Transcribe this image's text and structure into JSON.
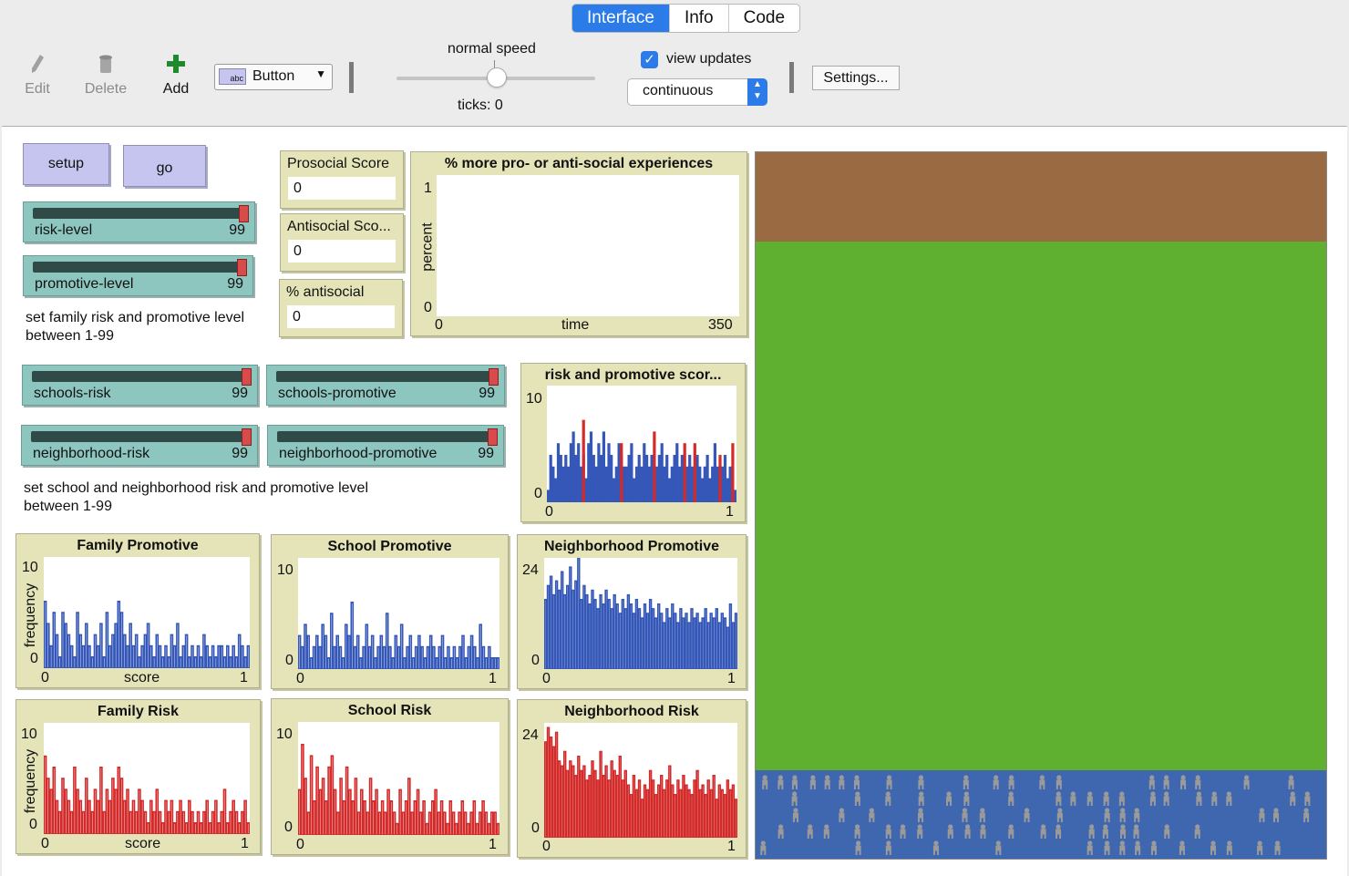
{
  "tabs": [
    "Interface",
    "Info",
    "Code"
  ],
  "toolbar": {
    "edit": "Edit",
    "delete": "Delete",
    "add": "Add",
    "widget_type": "Button",
    "speed_label": "normal speed",
    "speed_level": 0.5,
    "ticks": "ticks: 0",
    "view_updates": "view updates",
    "view_updates_checked": true,
    "update_mode": "continuous",
    "settings": "Settings..."
  },
  "buttons": {
    "setup": "setup",
    "go": "go"
  },
  "sliders": [
    {
      "name": "risk-level",
      "value": "99"
    },
    {
      "name": "promotive-level",
      "value": "99"
    },
    {
      "name": "schools-risk",
      "value": "99"
    },
    {
      "name": "schools-promotive",
      "value": "99"
    },
    {
      "name": "neighborhood-risk",
      "value": "99"
    },
    {
      "name": "neighborhood-promotive",
      "value": "99"
    }
  ],
  "notes": {
    "family": [
      "set family risk and promotive level",
      "between 1-99"
    ],
    "school": [
      "set school and neighborhood risk and promotive level",
      "between 1-99"
    ]
  },
  "monitors": [
    {
      "label": "Prosocial Score",
      "value": "0"
    },
    {
      "label": "Antisocial Sco...",
      "value": "0"
    },
    {
      "label": "% antisocial",
      "value": "0"
    }
  ],
  "main_plot": {
    "title": "% more pro- or anti-social experiences",
    "ylabel": "percent",
    "xlabel": "time",
    "ymax": "1",
    "ymin": "0",
    "xmin": "0",
    "xmax": "350"
  },
  "colors": {
    "blue": "#3457b8",
    "red": "#d32a2a",
    "patch_top": "#9a6b43",
    "patch_mid": "#5faf30",
    "patch_bottom": "#3f67b0",
    "turtle": "#9a9a9a"
  },
  "chart_data": [
    {
      "type": "bar",
      "title": "risk and promotive scor...",
      "ymax": "10",
      "ymin": "0",
      "xmin": "0",
      "xmax": "1",
      "series": [
        {
          "color": "blue",
          "values": [
            1,
            4,
            3,
            2,
            5,
            4,
            3,
            4,
            3,
            5,
            6,
            4,
            5,
            3,
            4,
            2,
            5,
            6,
            4,
            3,
            5,
            4,
            6,
            3,
            5,
            4,
            2,
            3,
            5,
            4,
            3,
            3,
            4,
            5,
            2,
            3,
            4,
            3,
            5,
            4,
            3,
            4,
            2,
            3,
            4,
            5,
            3,
            4,
            2,
            3,
            4,
            5,
            3,
            4,
            2,
            3,
            4,
            3,
            2,
            4,
            3,
            2,
            3,
            4,
            2,
            3,
            5,
            3,
            2,
            3,
            4,
            2,
            3,
            2,
            1
          ]
        },
        {
          "color": "red",
          "values": [
            0,
            0,
            0,
            0,
            0,
            0,
            0,
            0,
            0,
            0,
            0,
            0,
            0,
            0,
            7,
            0,
            0,
            0,
            0,
            0,
            0,
            0,
            0,
            0,
            0,
            0,
            0,
            0,
            0,
            5,
            0,
            0,
            0,
            0,
            0,
            0,
            0,
            0,
            0,
            0,
            0,
            0,
            6,
            0,
            0,
            0,
            0,
            0,
            0,
            0,
            0,
            0,
            0,
            0,
            5,
            0,
            0,
            0,
            5,
            0,
            0,
            0,
            0,
            0,
            0,
            0,
            0,
            0,
            4,
            0,
            0,
            0,
            0,
            5,
            0
          ]
        }
      ]
    },
    {
      "type": "bar",
      "title": "Family Promotive",
      "ylabel": "frequency",
      "xlabel": "score",
      "ymax": "10",
      "ymin": "0",
      "xmin": "0",
      "xmax": "1",
      "color": "blue",
      "values": [
        6,
        4,
        2,
        5,
        3,
        1,
        5,
        4,
        3,
        2,
        1,
        5,
        3,
        2,
        4,
        2,
        1,
        3,
        2,
        4,
        1,
        5,
        2,
        3,
        4,
        6,
        5,
        3,
        2,
        4,
        2,
        3,
        1,
        2,
        3,
        4,
        2,
        1,
        3,
        2,
        1,
        2,
        1,
        3,
        2,
        4,
        1,
        2,
        3,
        1,
        2,
        1,
        2,
        1,
        3,
        2,
        1,
        2,
        1,
        2,
        2,
        1,
        2,
        1,
        2,
        1,
        3,
        2,
        1,
        2
      ]
    },
    {
      "type": "bar",
      "title": "School Promotive",
      "ymax": "10",
      "ymin": "0",
      "xmin": "0",
      "xmax": "1",
      "color": "blue",
      "values": [
        3,
        2,
        4,
        3,
        1,
        2,
        3,
        2,
        4,
        3,
        1,
        5,
        2,
        3,
        2,
        1,
        4,
        3,
        6,
        2,
        3,
        1,
        2,
        4,
        2,
        3,
        1,
        2,
        3,
        2,
        5,
        2,
        1,
        3,
        2,
        4,
        1,
        2,
        3,
        1,
        2,
        3,
        2,
        1,
        2,
        3,
        2,
        1,
        2,
        3,
        1,
        2,
        1,
        2,
        1,
        2,
        3,
        1,
        2,
        3,
        2,
        1,
        4,
        2,
        1,
        2,
        1,
        1,
        1
      ]
    },
    {
      "type": "bar",
      "title": "Neighborhood Promotive",
      "ymax": "24",
      "ymin": "0",
      "xmin": "0",
      "xmax": "1",
      "color": "blue",
      "values": [
        15,
        18,
        20,
        16,
        19,
        17,
        21,
        16,
        18,
        22,
        17,
        19,
        24,
        15,
        18,
        16,
        14,
        17,
        15,
        13,
        16,
        14,
        17,
        15,
        13,
        16,
        14,
        12,
        15,
        13,
        16,
        14,
        12,
        15,
        13,
        11,
        14,
        12,
        15,
        13,
        11,
        14,
        12,
        10,
        13,
        11,
        14,
        12,
        10,
        13,
        11,
        12,
        10,
        13,
        11,
        12,
        10,
        11,
        13,
        10,
        12,
        11,
        13,
        10,
        12,
        11,
        9,
        14,
        10,
        12
      ]
    },
    {
      "type": "bar",
      "title": "Family Risk",
      "ylabel": "frequency",
      "xlabel": "score",
      "ymax": "10",
      "ymin": "0",
      "xmin": "0",
      "xmax": "1",
      "color": "red",
      "values": [
        7,
        5,
        4,
        6,
        3,
        2,
        5,
        4,
        3,
        2,
        6,
        4,
        3,
        2,
        5,
        3,
        2,
        4,
        3,
        6,
        2,
        4,
        3,
        5,
        4,
        6,
        5,
        3,
        4,
        2,
        3,
        2,
        4,
        3,
        2,
        1,
        3,
        2,
        4,
        2,
        1,
        3,
        2,
        3,
        1,
        2,
        3,
        2,
        1,
        3,
        2,
        1,
        2,
        1,
        2,
        3,
        1,
        2,
        3,
        1,
        2,
        4,
        1,
        2,
        3,
        2,
        1,
        2,
        3,
        1
      ]
    },
    {
      "type": "bar",
      "title": "School Risk",
      "ymax": "10",
      "ymin": "0",
      "xmin": "0",
      "xmax": "1",
      "color": "red",
      "values": [
        4,
        8,
        5,
        2,
        7,
        3,
        6,
        4,
        5,
        3,
        6,
        7,
        4,
        2,
        5,
        3,
        6,
        4,
        3,
        5,
        2,
        4,
        3,
        2,
        5,
        3,
        4,
        2,
        3,
        2,
        4,
        3,
        2,
        1,
        4,
        2,
        3,
        5,
        2,
        3,
        4,
        2,
        3,
        1,
        2,
        3,
        4,
        2,
        3,
        2,
        1,
        3,
        2,
        1,
        2,
        3,
        2,
        1,
        2,
        3,
        1,
        2,
        3,
        2,
        1,
        2,
        2,
        1
      ]
    },
    {
      "type": "bar",
      "title": "Neighborhood Risk",
      "ymax": "24",
      "ymin": "0",
      "xmin": "0",
      "xmax": "1",
      "color": "red",
      "values": [
        20,
        23,
        21,
        19,
        22,
        16,
        15,
        18,
        14,
        16,
        15,
        13,
        17,
        14,
        15,
        12,
        13,
        16,
        14,
        12,
        18,
        13,
        15,
        12,
        16,
        14,
        13,
        17,
        12,
        14,
        11,
        9,
        13,
        10,
        12,
        8,
        11,
        10,
        14,
        12,
        9,
        11,
        13,
        10,
        12,
        15,
        11,
        9,
        12,
        10,
        13,
        11,
        10,
        9,
        12,
        14,
        10,
        11,
        9,
        12,
        10,
        13,
        8,
        11,
        10,
        9,
        12,
        10,
        11,
        8
      ]
    }
  ],
  "chart_labels": {
    "y_max_10": "10",
    "y_max_24": "24",
    "zero": "0",
    "one": "1",
    "frequency": "frequency",
    "score": "score"
  }
}
